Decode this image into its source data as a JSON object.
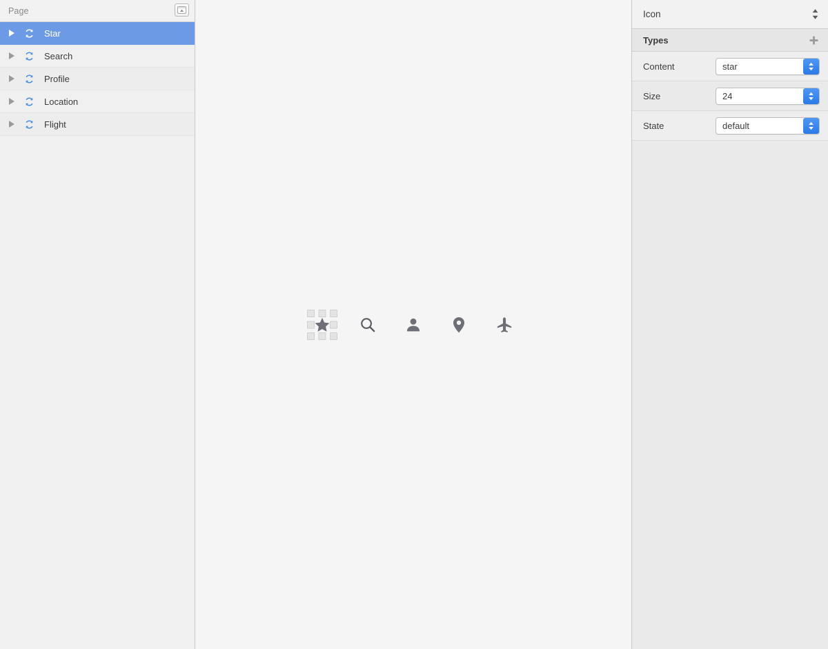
{
  "sidebar": {
    "header": {
      "title": "Page",
      "collapse_button_icon": "collapse-panel-icon"
    },
    "items": [
      {
        "label": "Star",
        "icon": "sync-icon",
        "selected": true,
        "disclosure": "chevron-right-icon"
      },
      {
        "label": "Search",
        "icon": "sync-icon",
        "selected": false,
        "disclosure": "chevron-right-icon"
      },
      {
        "label": "Profile",
        "icon": "sync-icon",
        "selected": false,
        "disclosure": "chevron-right-icon"
      },
      {
        "label": "Location",
        "icon": "sync-icon",
        "selected": false,
        "disclosure": "chevron-right-icon"
      },
      {
        "label": "Flight",
        "icon": "sync-icon",
        "selected": false,
        "disclosure": "chevron-right-icon"
      }
    ]
  },
  "canvas": {
    "icons": [
      {
        "name": "star-icon",
        "selected": true
      },
      {
        "name": "search-icon",
        "selected": false
      },
      {
        "name": "person-icon",
        "selected": false
      },
      {
        "name": "location-pin-icon",
        "selected": false
      },
      {
        "name": "airplane-icon",
        "selected": false
      }
    ]
  },
  "inspector": {
    "header": {
      "title": "Icon",
      "stepper_icon": "stepper-updown-icon"
    },
    "section": {
      "title": "Types",
      "add_icon": "plus-icon"
    },
    "properties": [
      {
        "label": "Content",
        "value": "star"
      },
      {
        "label": "Size",
        "value": "24"
      },
      {
        "label": "State",
        "value": "default"
      }
    ]
  },
  "colors": {
    "selection_blue": "#6d9ae4",
    "stepper_blue": "#2b7ae8",
    "sidebar_bg": "#f0f0f0",
    "canvas_bg": "#f5f5f5",
    "inspector_bg": "#eaeaea",
    "icon_gray": "#6e6e76",
    "layer_icon_blue": "#4a90e2"
  }
}
